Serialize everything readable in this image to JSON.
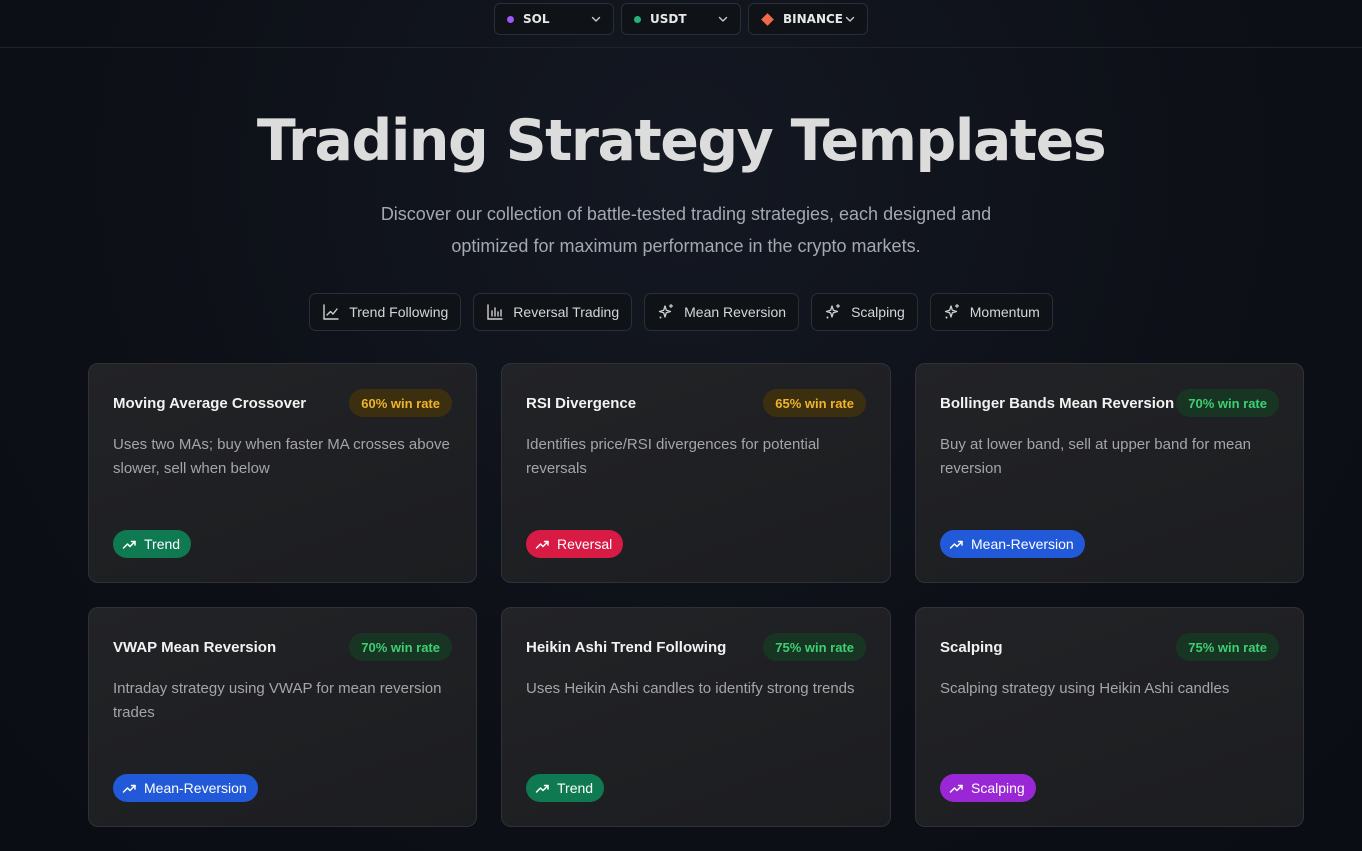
{
  "topbar": {
    "selectors": [
      {
        "label": "SOL",
        "dot_color": "#9b59f6"
      },
      {
        "label": "USDT",
        "dot_color": "#26b27a"
      },
      {
        "label": "BINANCE",
        "dot_color": "#f0694a"
      }
    ]
  },
  "hero": {
    "title": "Trading Strategy Templates",
    "subtitle": "Discover our collection of battle-tested trading strategies, each designed and optimized for maximum performance in the crypto markets."
  },
  "filters": [
    {
      "label": "Trend Following",
      "icon": "line-chart-icon"
    },
    {
      "label": "Reversal Trading",
      "icon": "bar-chart-icon"
    },
    {
      "label": "Mean Reversion",
      "icon": "sparkles-icon"
    },
    {
      "label": "Scalping",
      "icon": "sparkles-icon"
    },
    {
      "label": "Momentum",
      "icon": "sparkles-icon"
    }
  ],
  "cards": [
    {
      "title": "Moving Average Crossover",
      "win_rate": "60% win rate",
      "win_tone": "amber",
      "description": "Uses two MAs; buy when faster MA crosses above slower, sell when below",
      "tag": "Trend",
      "tag_color": "#0f7a52"
    },
    {
      "title": "RSI Divergence",
      "win_rate": "65% win rate",
      "win_tone": "amber",
      "description": "Identifies price/RSI divergences for potential reversals",
      "tag": "Reversal",
      "tag_color": "#d81b45"
    },
    {
      "title": "Bollinger Bands Mean Reversion",
      "win_rate": "70% win rate",
      "win_tone": "green",
      "description": "Buy at lower band, sell at upper band for mean reversion",
      "tag": "Mean-Reversion",
      "tag_color": "#2259d8"
    },
    {
      "title": "VWAP Mean Reversion",
      "win_rate": "70% win rate",
      "win_tone": "green",
      "description": "Intraday strategy using VWAP for mean reversion trades",
      "tag": "Mean-Reversion",
      "tag_color": "#2259d8"
    },
    {
      "title": "Heikin Ashi Trend Following",
      "win_rate": "75% win rate",
      "win_tone": "green",
      "description": "Uses Heikin Ashi candles to identify strong trends",
      "tag": "Trend",
      "tag_color": "#0f7a52"
    },
    {
      "title": "Scalping",
      "win_rate": "75% win rate",
      "win_tone": "green",
      "description": "Scalping strategy using Heikin Ashi candles",
      "tag": "Scalping",
      "tag_color": "#9a27d6"
    }
  ],
  "tones": {
    "amber": {
      "bg": "#3b2f10",
      "fg": "#f0b429"
    },
    "green": {
      "bg": "#183524",
      "fg": "#3ecf72"
    }
  }
}
